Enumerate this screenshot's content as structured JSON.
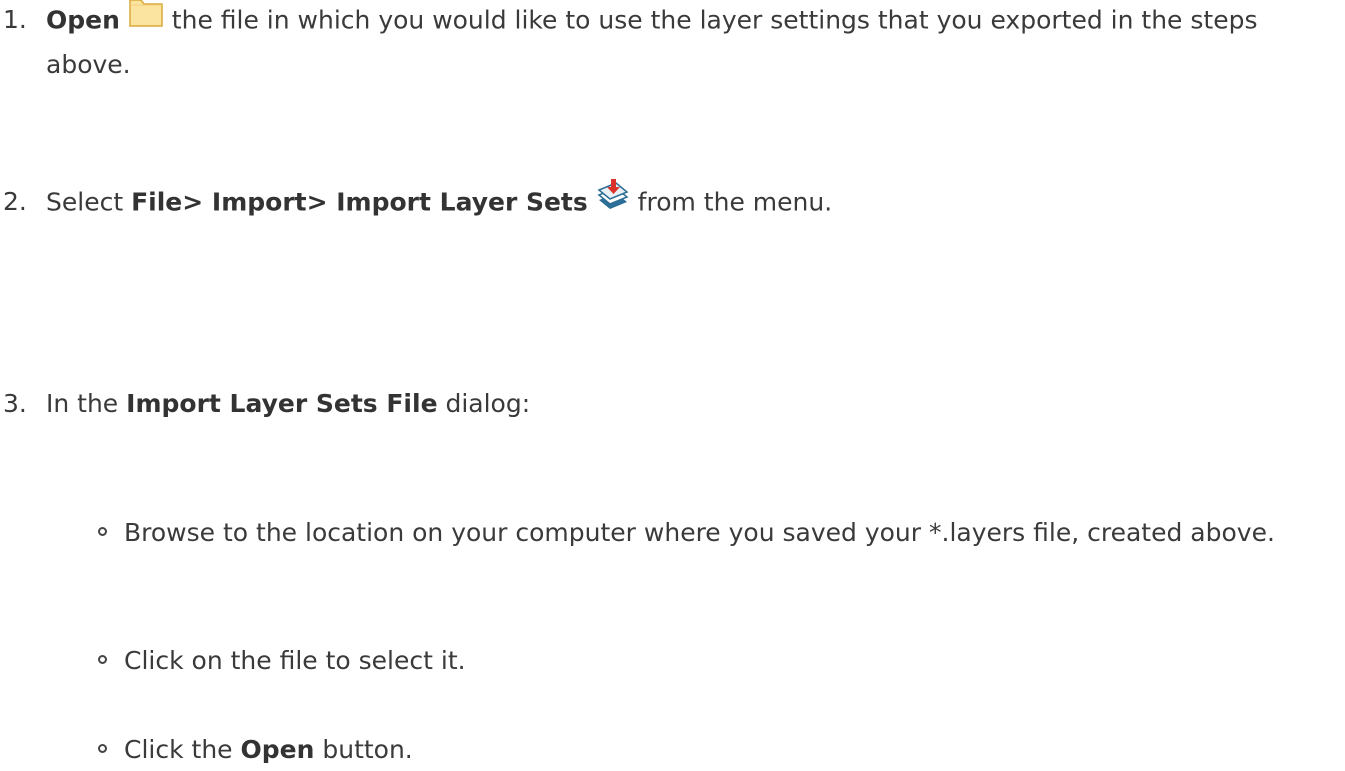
{
  "steps": [
    {
      "number": "1.",
      "bold": "Open",
      "icon": "folder-icon",
      "text": " the file in which you would like to use the layer settings that you exported in the steps above."
    },
    {
      "number": "2.",
      "prefix": "Select ",
      "bold": "File> Import> Import Layer Sets",
      "icon": "import-layers-icon",
      "text": " from the menu."
    },
    {
      "number": "3.",
      "prefix": "In the ",
      "bold": "Import Layer Sets File",
      "text": " dialog:",
      "substeps": [
        {
          "text": "Browse to the location on your computer where you saved your *.layers file, created above."
        },
        {
          "text": "Click on the file to select it."
        },
        {
          "prefix": "Click the ",
          "bold": "Open",
          "text": " button."
        }
      ]
    }
  ],
  "colors": {
    "text": "#3a3a3a",
    "folder_fill": "#fbe3a0",
    "folder_stroke": "#d9a93a",
    "import_red": "#d9322a",
    "import_blue": "#2c6e95"
  }
}
